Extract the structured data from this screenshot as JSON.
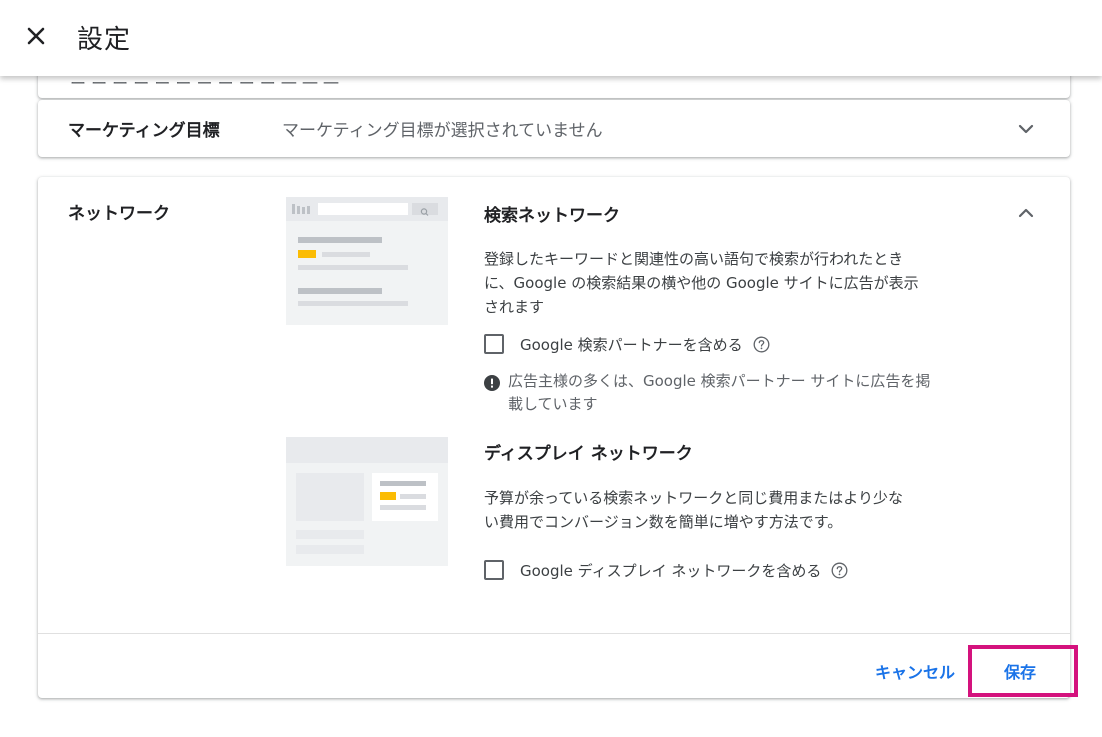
{
  "header": {
    "title": "設定"
  },
  "previous_row": {
    "partial_text": "ー ー ー ー ー ー ー ー ー ー 一 一 一"
  },
  "marketing": {
    "label": "マーケティング目標",
    "value": "マーケティング目標が選択されていません"
  },
  "network": {
    "label": "ネットワーク",
    "search": {
      "title": "検索ネットワーク",
      "description_line1": "登録したキーワードと関連性の高い語句で検索が行われたとき",
      "description_line2": "に、Google の検索結果の横や他の Google サイトに広告が表示",
      "description_line3": "されます",
      "checkbox_label": "Google 検索パートナーを含める",
      "checkbox_checked": false,
      "info_line1": "広告主様の多くは、Google 検索パートナー サイトに広告を掲",
      "info_line2": "載しています"
    },
    "display": {
      "title": "ディスプレイ ネットワーク",
      "description_line1": "予算が余っている検索ネットワークと同じ費用またはより少な",
      "description_line2": "い費用でコンバージョン数を簡単に増やす方法です。",
      "checkbox_label": "Google ディスプレイ ネットワークを含める",
      "checkbox_checked": false
    }
  },
  "footer": {
    "cancel_label": "キャンセル",
    "save_label": "保存"
  },
  "colors": {
    "accent": "#1a73e8",
    "highlight": "#d4127d",
    "illustration_yellow": "#fbbc04"
  },
  "icons": [
    "close-icon",
    "chevron-down-icon",
    "chevron-up-icon",
    "help-icon",
    "info-icon"
  ]
}
